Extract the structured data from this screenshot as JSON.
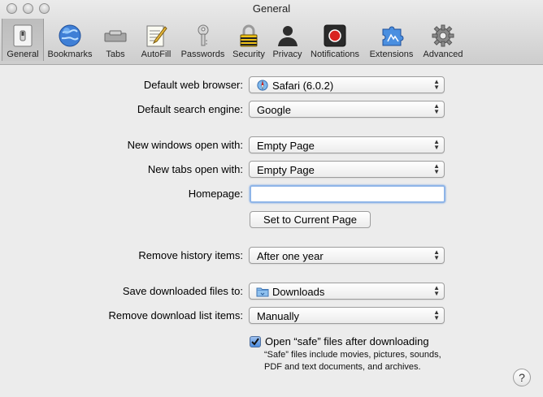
{
  "window": {
    "title": "General"
  },
  "toolbar": {
    "tabs": [
      {
        "label": "General",
        "icon": "general-switch-icon",
        "selected": true
      },
      {
        "label": "Bookmarks",
        "icon": "bookmarks-globe-icon",
        "selected": false
      },
      {
        "label": "Tabs",
        "icon": "tabs-icon",
        "selected": false
      },
      {
        "label": "AutoFill",
        "icon": "autofill-form-icon",
        "selected": false
      },
      {
        "label": "Passwords",
        "icon": "key-icon",
        "selected": false
      },
      {
        "label": "Security",
        "icon": "padlock-icon",
        "selected": false
      },
      {
        "label": "Privacy",
        "icon": "person-silhouette-icon",
        "selected": false
      },
      {
        "label": "Notifications",
        "icon": "notifications-record-icon",
        "selected": false
      },
      {
        "label": "Extensions",
        "icon": "puzzle-piece-icon",
        "selected": false
      },
      {
        "label": "Advanced",
        "icon": "gear-icon",
        "selected": false
      }
    ]
  },
  "form": {
    "default_browser": {
      "label": "Default web browser:",
      "value": "Safari (6.0.2)",
      "icon": "safari-compass-icon"
    },
    "search_engine": {
      "label": "Default search engine:",
      "value": "Google"
    },
    "new_windows": {
      "label": "New windows open with:",
      "value": "Empty Page"
    },
    "new_tabs": {
      "label": "New tabs open with:",
      "value": "Empty Page"
    },
    "homepage": {
      "label": "Homepage:",
      "value": ""
    },
    "set_current_page": {
      "label": "Set to Current Page"
    },
    "remove_history": {
      "label": "Remove history items:",
      "value": "After one year"
    },
    "save_downloads": {
      "label": "Save downloaded files to:",
      "value": "Downloads",
      "icon": "folder-icon"
    },
    "remove_downloads": {
      "label": "Remove download list items:",
      "value": "Manually"
    },
    "open_safe_files": {
      "label": "Open “safe” files after downloading",
      "checked": true,
      "note_lines": [
        "“Safe” files include movies, pictures, sounds,",
        "PDF and text documents, and archives."
      ]
    },
    "help": {
      "label": "?"
    }
  },
  "colors": {
    "accent": "#4d8de0",
    "focus_ring": "#8fb5e8",
    "record_red": "#d9231f"
  }
}
